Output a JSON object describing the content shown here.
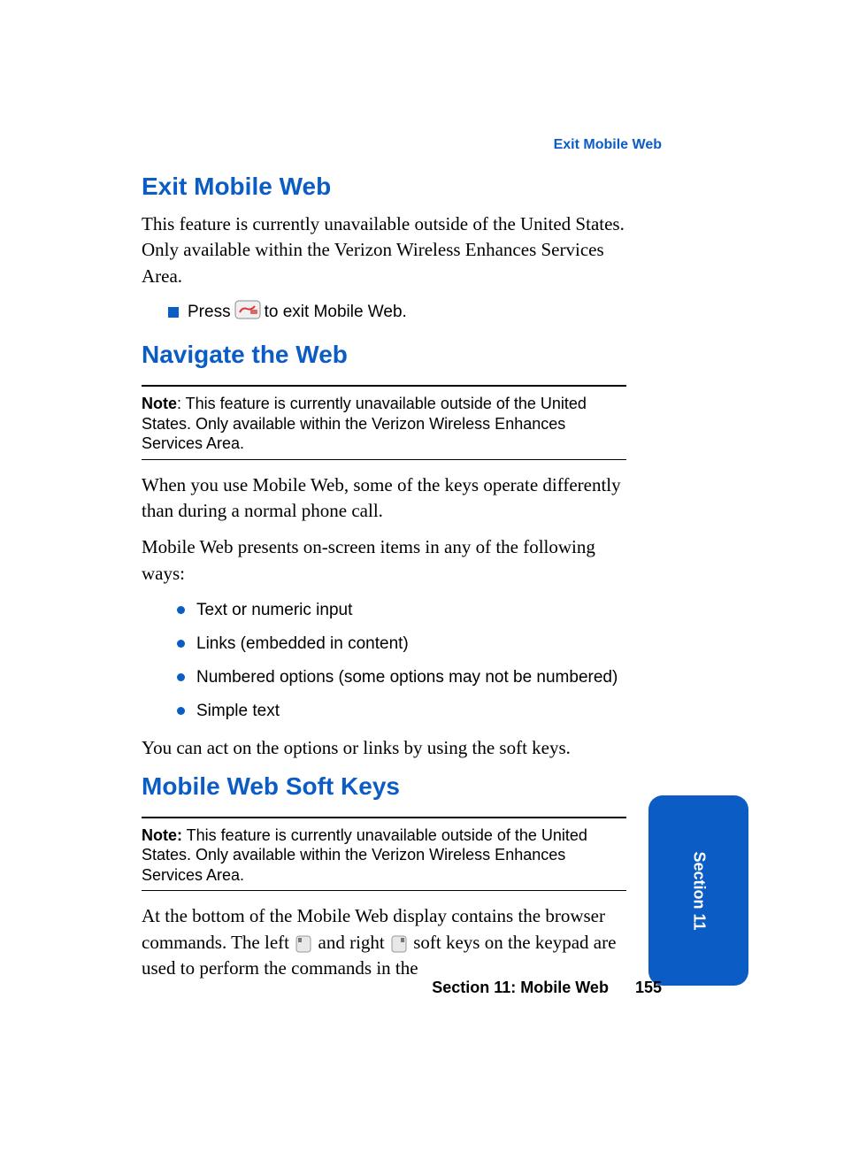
{
  "running_header": "Exit Mobile Web",
  "section1": {
    "heading": "Exit Mobile Web",
    "para": "This feature is currently unavailable outside of the United States. Only available within the Verizon Wireless Enhances Services Area.",
    "bullet_press": "Press",
    "bullet_rest": " to exit Mobile Web."
  },
  "section2": {
    "heading": "Navigate the Web",
    "note_label": "Note",
    "note_body": ": This feature is currently unavailable outside of the United States. Only available within the Verizon Wireless Enhances Services Area.",
    "para1": "When you use Mobile Web, some of the keys operate differently than during a normal phone call.",
    "para2": "Mobile Web presents on-screen items in any of the following ways:",
    "list": [
      "Text or numeric input",
      "Links (embedded in content)",
      "Numbered options (some options may not be numbered)",
      "Simple text"
    ],
    "para3": "You can act on the options or links by using the soft keys."
  },
  "section3": {
    "heading": "Mobile Web Soft Keys",
    "note_label": "Note:",
    "note_body": " This feature is currently unavailable outside of the United States. Only available within the Verizon Wireless Enhances Services Area.",
    "para_a": "At the bottom of the Mobile Web display contains the browser commands. The left ",
    "para_b": " and right ",
    "para_c": " soft keys on the keypad are used to perform the commands in the"
  },
  "footer": {
    "section_label": "Section 11: Mobile Web",
    "page_number": "155"
  },
  "tab_label": "Section 11"
}
